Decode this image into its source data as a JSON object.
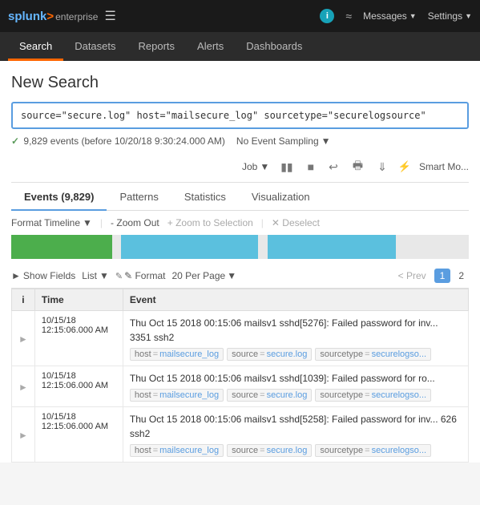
{
  "topbar": {
    "logo": "splunk>enterprise",
    "logo_main": "splunk>",
    "logo_suffix": "enterprise",
    "messages_label": "Messages",
    "settings_label": "Settings"
  },
  "tabs": {
    "items": [
      {
        "label": "Search",
        "active": true
      },
      {
        "label": "Datasets"
      },
      {
        "label": "Reports"
      },
      {
        "label": "Alerts"
      },
      {
        "label": "Dashboards"
      }
    ]
  },
  "page": {
    "title": "New Search"
  },
  "search": {
    "query": "source=\"secure.log\" host=\"mailsecure_log\" sourcetype=\"securelogsource\"",
    "event_count": "9,829 events (before 10/20/18 9:30:24.000 AM)",
    "no_event_sampling": "No Event Sampling"
  },
  "job_bar": {
    "job_label": "Job",
    "smart_mode": "Smart Mo..."
  },
  "content_tabs": [
    {
      "label": "Events (9,829)",
      "active": true
    },
    {
      "label": "Patterns"
    },
    {
      "label": "Statistics"
    },
    {
      "label": "Visualization"
    }
  ],
  "timeline": {
    "format_label": "Format Timeline",
    "zoom_out": "- Zoom Out",
    "zoom_selection": "+ Zoom to Selection",
    "deselect": "✕ Deselect"
  },
  "results_toolbar": {
    "show_fields": "> Show Fields",
    "list_label": "List",
    "format_label": "✎ Format",
    "per_page": "20 Per Page",
    "prev": "< Prev",
    "page_1": "1",
    "page_2": "2"
  },
  "table": {
    "headers": [
      "i",
      "Time",
      "Event"
    ],
    "rows": [
      {
        "time": "10/15/18\n12:15:06.000 AM",
        "event_text": "Thu Oct 15 2018 00:15:06 mailsv1 sshd[5276]: Failed password for inv... 3351 ssh2",
        "tags": [
          {
            "key": "host",
            "val": "mailsecure_log"
          },
          {
            "key": "source",
            "val": "secure.log"
          },
          {
            "key": "sourcetype",
            "val": "securelogso..."
          }
        ]
      },
      {
        "time": "10/15/18\n12:15:06.000 AM",
        "event_text": "Thu Oct 15 2018 00:15:06 mailsv1 sshd[1039]: Failed password for ro...",
        "tags": [
          {
            "key": "host",
            "val": "mailsecure_log"
          },
          {
            "key": "source",
            "val": "secure.log"
          },
          {
            "key": "sourcetype",
            "val": "securelogso..."
          }
        ]
      },
      {
        "time": "10/15/18\n12:15:06.000 AM",
        "event_text": "Thu Oct 15 2018 00:15:06 mailsv1 sshd[5258]: Failed password for inv... 626 ssh2",
        "tags": [
          {
            "key": "host",
            "val": "mailsecure_log"
          },
          {
            "key": "source",
            "val": "secure.log"
          },
          {
            "key": "sourcetype",
            "val": "securelogso..."
          }
        ]
      }
    ]
  },
  "colors": {
    "accent": "#5a9de0",
    "orange": "#ff6600",
    "tag_val": "#5a9de0"
  }
}
